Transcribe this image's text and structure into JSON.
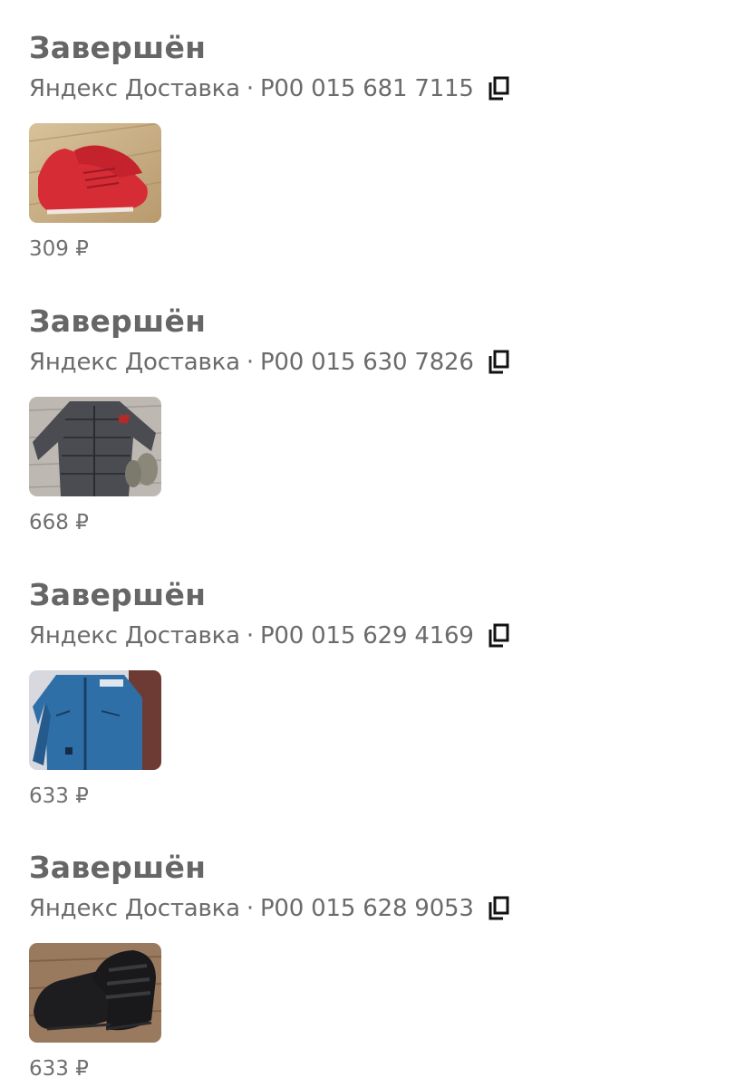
{
  "orders": [
    {
      "status": "Завершён",
      "carrier": "Яндекс Доставка",
      "separator": "·",
      "tracking": "P00 015 681 7115",
      "price": "309 ₽",
      "image_icon": "red-sneakers-photo"
    },
    {
      "status": "Завершён",
      "carrier": "Яндекс Доставка",
      "separator": "·",
      "tracking": "P00 015 630 7826",
      "price": "668 ₽",
      "image_icon": "gray-jacket-photo"
    },
    {
      "status": "Завершён",
      "carrier": "Яндекс Доставка",
      "separator": "·",
      "tracking": "P00 015 629 4169",
      "price": "633 ₽",
      "image_icon": "blue-jacket-photo"
    },
    {
      "status": "Завершён",
      "carrier": "Яндекс Доставка",
      "separator": "·",
      "tracking": "P00 015 628 9053",
      "price": "633 ₽",
      "image_icon": "black-shoes-photo"
    }
  ],
  "icons": {
    "copy": "copy-icon"
  },
  "colors": {
    "text": "#666666",
    "background": "#ffffff"
  }
}
